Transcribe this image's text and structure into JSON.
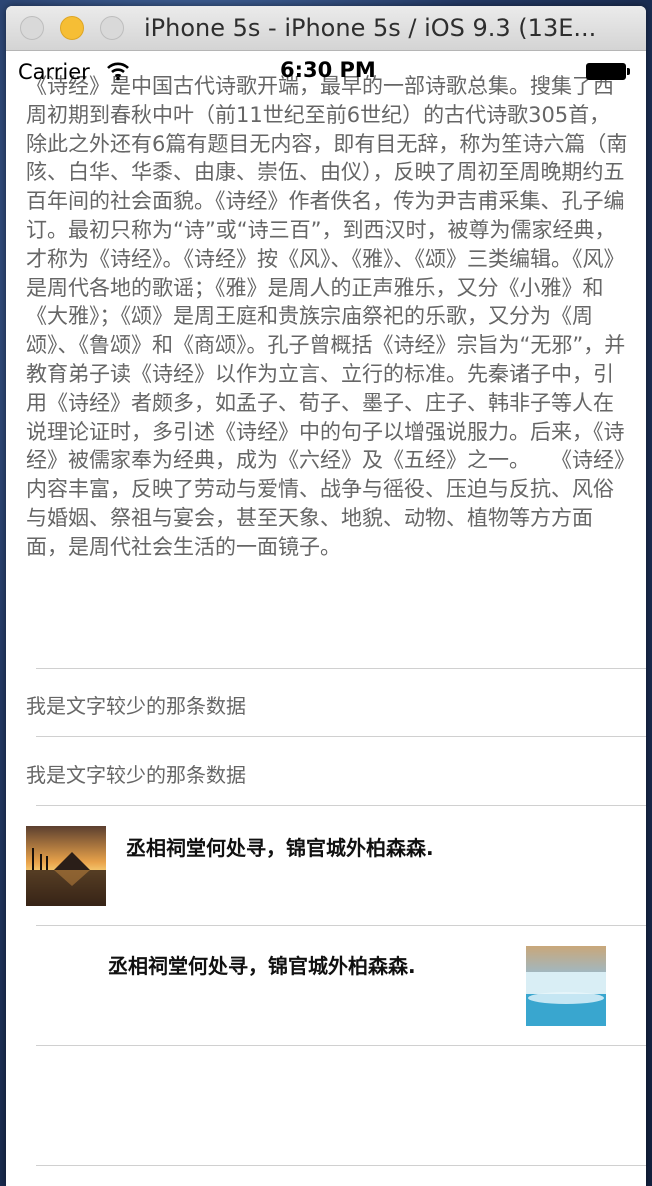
{
  "window": {
    "title": "iPhone 5s - iPhone 5s / iOS 9.3 (13E..."
  },
  "status_bar": {
    "carrier": "Carrier",
    "time": "6:30 PM"
  },
  "cells": {
    "long_text": "《诗经》是中国古代诗歌开端，最早的一部诗歌总集。搜集了西周初期到春秋中叶（前11世纪至前6世纪）的古代诗歌305首，除此之外还有6篇有题目无内容，即有目无辞，称为笙诗六篇（南陔、白华、华黍、由康、崇伍、由仪），反映了周初至周晚期约五百年间的社会面貌。《诗经》作者佚名，传为尹吉甫采集、孔子编订。最初只称为“诗”或“诗三百”，到西汉时，被尊为儒家经典，才称为《诗经》。《诗经》按《风》、《雅》、《颂》三类编辑。《风》是周代各地的歌谣；《雅》是周人的正声雅乐，又分《小雅》和《大雅》；《颂》是周王庭和贵族宗庙祭祀的乐歌，又分为《周颂》、《鲁颂》和《商颂》。孔子曾概括《诗经》宗旨为“无邪”，并教育弟子读《诗经》以作为立言、立行的标准。先秦诸子中，引用《诗经》者颇多，如孟子、荀子、墨子、庄子、韩非子等人在说理论证时，多引述《诗经》中的句子以增强说服力。后来，《诗经》被儒家奉为经典，成为《六经》及《五经》之一。　　《诗经》内容丰富，反映了劳动与爱情、战争与徭役、压迫与反抗、风俗与婚姻、祭祖与宴会，甚至天象、地貌、动物、植物等方方面面，是周代社会生活的一面镜子。",
    "short_text_1": "我是文字较少的那条数据",
    "short_text_2": "我是文字较少的那条数据",
    "image_left_text": "丞相祠堂何处寻，锦官城外柏森森.",
    "image_right_text": "丞相祠堂何处寻，锦官城外柏森森."
  }
}
